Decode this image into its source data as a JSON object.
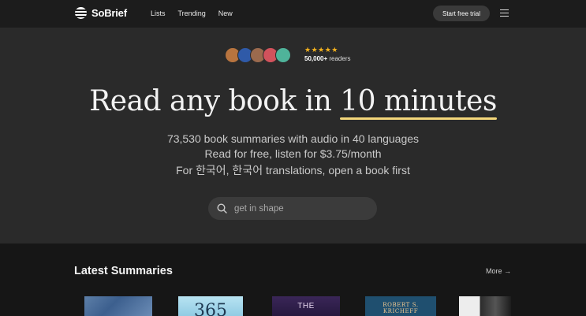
{
  "nav": {
    "brand": "SoBrief",
    "links": [
      "Lists",
      "Trending",
      "New"
    ],
    "cta_label": "Start free trial",
    "menu_icon": "hamburger-menu-icon"
  },
  "hero": {
    "avatars": [
      "#b8743f",
      "#2f5aa8",
      "#9b6a4e",
      "#d2525c",
      "#4fb39a"
    ],
    "stars": "★★★★★",
    "readers_count": "50,000+",
    "readers_suffix": " readers",
    "headline_prefix": "Read any book in ",
    "headline_highlight": "10 minutes",
    "line1": "73,530 book summaries with audio in 40 languages",
    "line2": "Read for free, listen for $3.75/month",
    "line3": "For 한국어, 한국어 translations, open a book first",
    "search_placeholder": "get in shape",
    "star_color": "#f5b21d",
    "highlight_color": "#f4d77a"
  },
  "latest": {
    "title": "Latest Summaries",
    "more_label": "More →",
    "books": [
      {
        "cover_text": ""
      },
      {
        "cover_text": "365"
      },
      {
        "cover_text": "THE"
      },
      {
        "cover_text": "ROBERT S. KRICHEFF"
      },
      {
        "cover_text": ""
      }
    ]
  }
}
